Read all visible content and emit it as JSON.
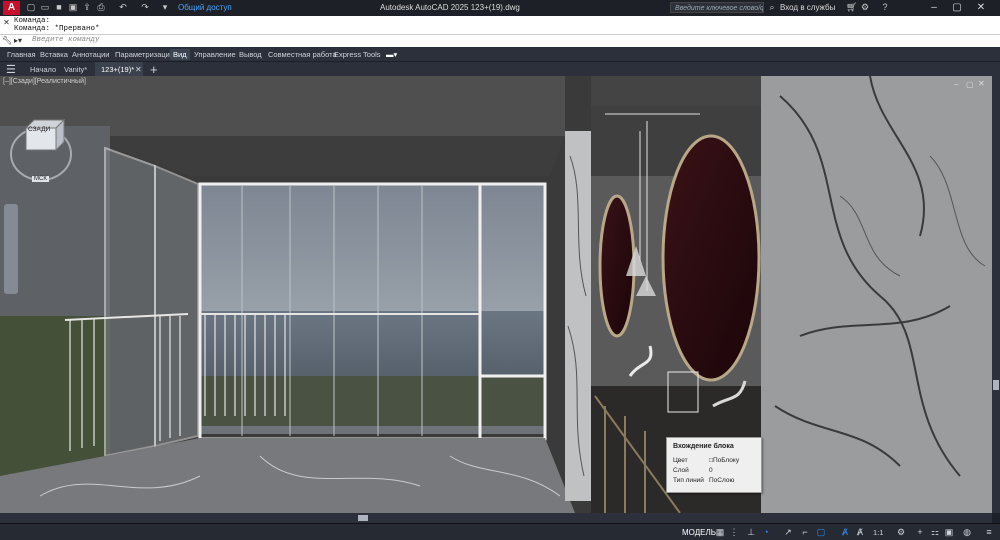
{
  "titlebar": {
    "app_letter": "A",
    "share_label": "Общий доступ",
    "window_title": "Autodesk AutoCAD 2025    123+(19).dwg",
    "search_placeholder": "Введите ключевое слово/фразу",
    "login_label": "Вход в службы"
  },
  "command": {
    "history": [
      "Команда:",
      "Команда: *Прервано*"
    ],
    "input_placeholder": "Введите команду"
  },
  "ribbon": {
    "tabs": [
      "Главная",
      "Вставка",
      "Аннотации",
      "Параметризация",
      "Вид",
      "Управление",
      "Вывод",
      "Совместная работа",
      "Express Tools"
    ],
    "active_tab": "Вид"
  },
  "file_tabs": {
    "tabs": [
      "Начало",
      "Vanity*",
      "123+(19)*"
    ],
    "active_tab": "123+(19)*"
  },
  "viewport": {
    "status_label": "[–][Сзади][Реалистичный]",
    "viewcube_face": "СЗАДИ",
    "viewcube_compass": "МСК"
  },
  "tooltip": {
    "title": "Вхождение блока",
    "rows": [
      {
        "label": "Цвет",
        "value": "ПоБлоку"
      },
      {
        "label": "Слой",
        "value": "0"
      },
      {
        "label": "Тип линий",
        "value": "ПоСлою"
      }
    ]
  },
  "statusbar": {
    "model_label": "МОДЕЛЬ",
    "scale_label": "1:1"
  },
  "colors": {
    "accent": "#2e8cff",
    "app_button": "#c8102e",
    "mirror_frame_dark": "#2a0d12"
  }
}
